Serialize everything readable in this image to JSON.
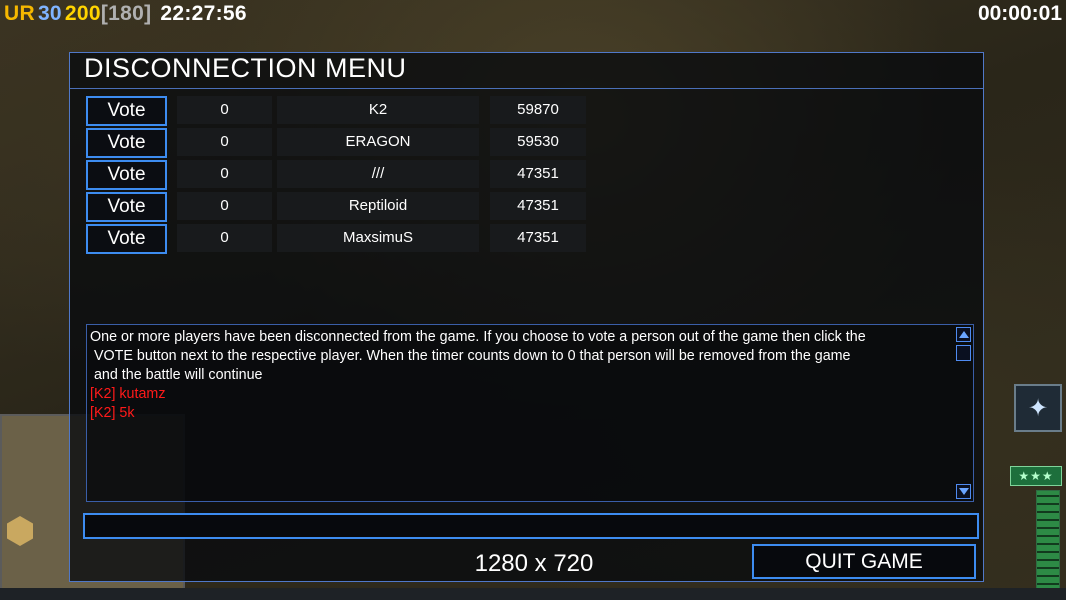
{
  "hud": {
    "faction": "UR",
    "val1": "30",
    "val2": "200",
    "val3": "[180]",
    "clock": "22:27:56",
    "timer": "00:00:01",
    "colors": {
      "faction": "#f5b800",
      "val1": "#7fb4ff",
      "val2": "#ffd400",
      "val3": "#b0b0b0",
      "clock": "#ffffff"
    }
  },
  "background": {
    "sidebar_icon": "satellite-icon",
    "stars": "★★★"
  },
  "dialog": {
    "title": "DISCONNECTION MENU",
    "players": [
      {
        "vote_label": "Vote",
        "votes": "0",
        "name": "K2",
        "ping": "59870"
      },
      {
        "vote_label": "Vote",
        "votes": "0",
        "name": "ERAGON",
        "ping": "59530"
      },
      {
        "vote_label": "Vote",
        "votes": "0",
        "name": "///",
        "ping": "47351"
      },
      {
        "vote_label": "Vote",
        "votes": "0",
        "name": "Reptiloid",
        "ping": "47351"
      },
      {
        "vote_label": "Vote",
        "votes": "0",
        "name": "MaxsimuS",
        "ping": "47351"
      }
    ],
    "message_lines": [
      "One or more players have been disconnected from the game. If you choose to vote a person out of the game then click the",
      " VOTE button next to the respective player. When the timer counts down to 0 that person will be removed from the game",
      " and the battle will continue"
    ],
    "chat_lines": [
      "[K2] kutamz",
      "[K2] 5k"
    ],
    "chat_input_value": "",
    "quit_label": "QUIT GAME",
    "resolution_label": "1280 x 720",
    "accent_color": "#3d8cf0",
    "chat_color": "#ff1a1a"
  }
}
